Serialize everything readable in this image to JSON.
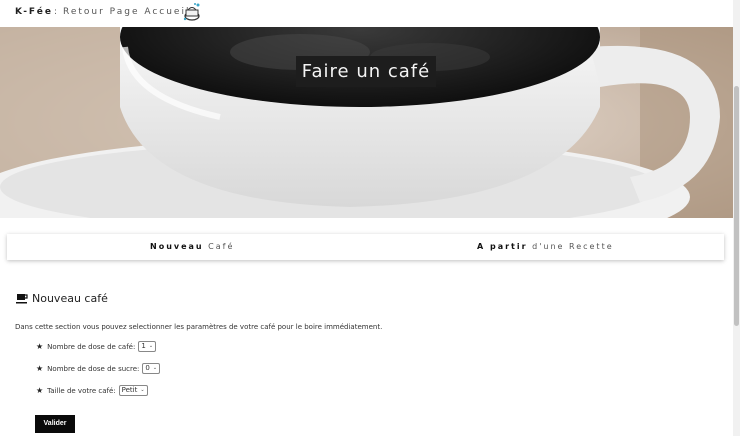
{
  "nav": {
    "brand": "K-Fée",
    "separator": ":",
    "home_link": "Retour Page Accueil",
    "logo_icon": "coffee-machine-logo-icon"
  },
  "hero": {
    "title": "Faire un café"
  },
  "tabs": {
    "new_bold": "Nouveau",
    "new_rest": "Café",
    "recipe_bold": "A partir",
    "recipe_rest": "d'une Recette"
  },
  "section": {
    "icon": "coffee-cup-icon",
    "title": "Nouveau café",
    "intro": "Dans cette section vous pouvez selectionner les paramètres de votre café pour le boire immédiatement."
  },
  "form": {
    "dose_cafe": {
      "label": "Nombre de dose de café:",
      "value": "1"
    },
    "dose_sucre": {
      "label": "Nombre de dose de sucre:",
      "value": "0"
    },
    "taille": {
      "label": "Taille de votre café:",
      "value": "Petit"
    },
    "submit_label": "Valider"
  }
}
